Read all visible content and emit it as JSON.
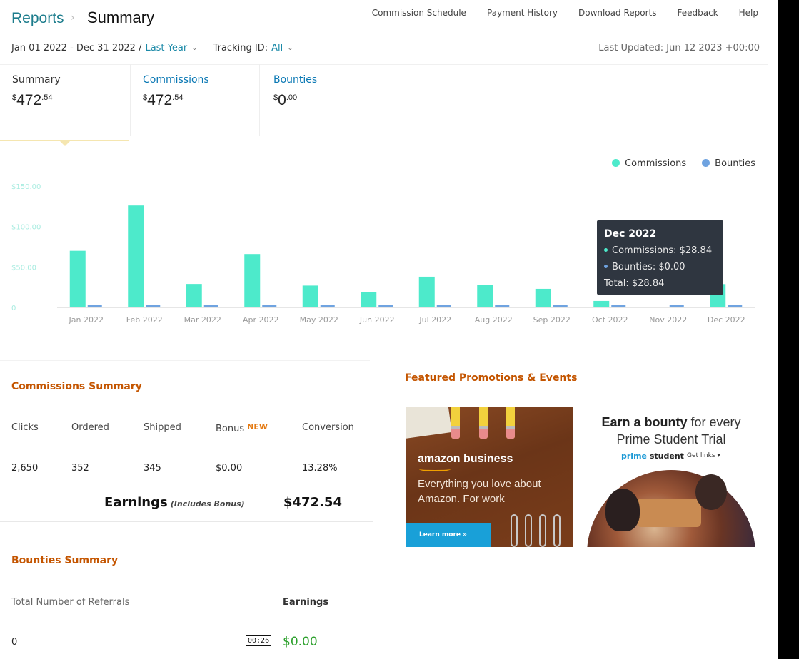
{
  "header": {
    "breadcrumb": "Reports",
    "separator": "›",
    "title": "Summary",
    "nav": [
      "Commission Schedule",
      "Payment History",
      "Download Reports",
      "Feedback",
      "Help"
    ]
  },
  "filters": {
    "date_range": "Jan 01 2022 - Dec 31 2022 /",
    "period": "Last Year",
    "tracking_label": "Tracking ID:",
    "tracking_value": "All",
    "last_updated": "Last Updated: Jun 12 2023 +00:00"
  },
  "tabs": [
    {
      "label": "Summary",
      "currency": "$",
      "whole": "472",
      "cents": ".54"
    },
    {
      "label": "Commissions",
      "currency": "$",
      "whole": "472",
      "cents": ".54"
    },
    {
      "label": "Bounties",
      "currency": "$",
      "whole": "0",
      "cents": ".00"
    }
  ],
  "chart_data": {
    "type": "bar",
    "categories": [
      "Jan 2022",
      "Feb 2022",
      "Mar 2022",
      "Apr 2022",
      "May 2022",
      "Jun 2022",
      "Jul 2022",
      "Aug 2022",
      "Sep 2022",
      "Oct 2022",
      "Nov 2022",
      "Dec 2022"
    ],
    "series": [
      {
        "name": "Commissions",
        "values": [
          70,
          126,
          29,
          66,
          27,
          19,
          38,
          28,
          23,
          8,
          0,
          28.84
        ],
        "color": "#4deacb"
      },
      {
        "name": "Bounties",
        "values": [
          0,
          0,
          0,
          0,
          0,
          0,
          0,
          0,
          0,
          0,
          0,
          0
        ],
        "color": "#6fa3e0"
      }
    ],
    "yticks": [
      "$150.00",
      "$100.00",
      "$50.00",
      "0"
    ],
    "ytick_values": [
      150,
      100,
      50,
      0
    ],
    "ylim": [
      0,
      150
    ],
    "legend_position": "top-right",
    "grid": false
  },
  "tooltip": {
    "title": "Dec 2022",
    "commissions": "Commissions: $28.84",
    "bounties": "Bounties: $0.00",
    "total": "Total: $28.84"
  },
  "commissions_summary": {
    "title": "Commissions Summary",
    "headers": [
      "Clicks",
      "Ordered",
      "Shipped",
      "Bonus",
      "Conversion"
    ],
    "new_badge": "NEW",
    "values": [
      "2,650",
      "352",
      "345",
      "$0.00",
      "13.28%"
    ],
    "earnings_label": "Earnings",
    "earnings_note": "(Includes Bonus)",
    "earnings_value": "$472.54"
  },
  "bounties_summary": {
    "title": "Bounties Summary",
    "referrals_label": "Total Number of Referrals",
    "earnings_label": "Earnings",
    "referrals_value": "0",
    "earnings_value": "$0.00"
  },
  "time_badge": "00:26",
  "promotions": {
    "title": "Featured Promotions & Events",
    "promo1": {
      "brand": "amazon business",
      "text": "Everything you love about Amazon. For work",
      "button": "Learn more »"
    },
    "promo2": {
      "head_pre": "Earn a bounty",
      "head_post": "for every Prime Student Trial",
      "logo_a": "prime",
      "logo_b": "student",
      "links": "Get links ▾"
    }
  }
}
